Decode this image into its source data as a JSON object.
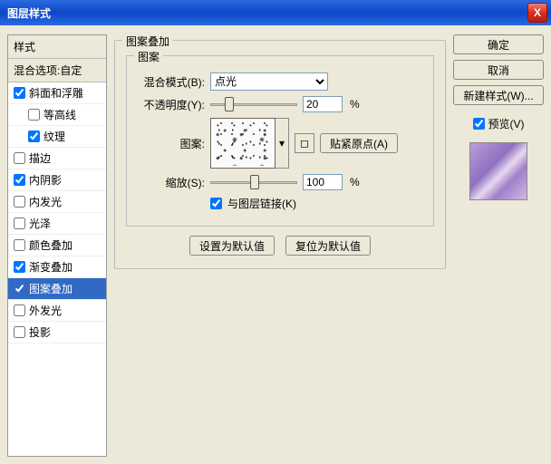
{
  "titlebar": {
    "title": "图层样式",
    "close_x": "X"
  },
  "left": {
    "header": "样式",
    "options_header": "混合选项:自定",
    "items": [
      {
        "label": "斜面和浮雕",
        "checked": true,
        "sub": false
      },
      {
        "label": "等高线",
        "checked": false,
        "sub": true
      },
      {
        "label": "纹理",
        "checked": true,
        "sub": true
      },
      {
        "label": "描边",
        "checked": false,
        "sub": false
      },
      {
        "label": "内阴影",
        "checked": true,
        "sub": false
      },
      {
        "label": "内发光",
        "checked": false,
        "sub": false
      },
      {
        "label": "光泽",
        "checked": false,
        "sub": false
      },
      {
        "label": "颜色叠加",
        "checked": false,
        "sub": false
      },
      {
        "label": "渐变叠加",
        "checked": true,
        "sub": false
      },
      {
        "label": "图案叠加",
        "checked": true,
        "sub": false,
        "selected": true
      },
      {
        "label": "外发光",
        "checked": false,
        "sub": false
      },
      {
        "label": "投影",
        "checked": false,
        "sub": false
      }
    ]
  },
  "panel": {
    "group_title": "图案叠加",
    "inner_title": "图案",
    "blend_label": "混合模式(B):",
    "blend_value": "点光",
    "opacity_label": "不透明度(Y):",
    "opacity_value": "20",
    "pct": "%",
    "pattern_label": "图案:",
    "snap_btn": "贴紧原点(A)",
    "scale_label": "缩放(S):",
    "scale_value": "100",
    "link_label": "与图层链接(K)",
    "link_checked": true,
    "default_btn": "设置为默认值",
    "reset_btn": "复位为默认值"
  },
  "right": {
    "ok": "确定",
    "cancel": "取消",
    "newstyle": "新建样式(W)...",
    "preview_label": "预览(V)",
    "preview_checked": true
  }
}
